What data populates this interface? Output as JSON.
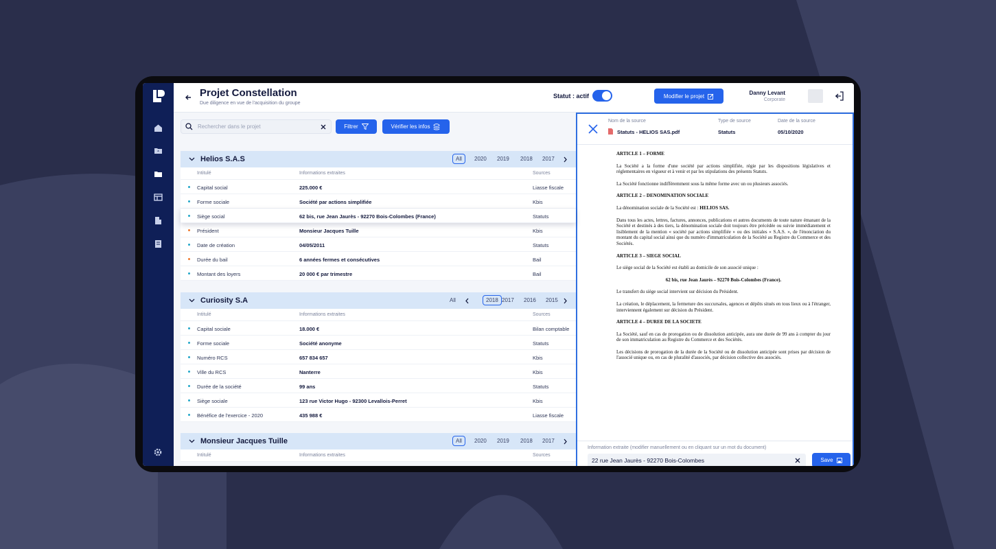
{
  "colors": {
    "accent": "#2563eb",
    "sidebar": "#0f1f57",
    "background": "#2a2e4b"
  },
  "header": {
    "title": "Projet Constellation",
    "subtitle": "Due diligence en vue de l'acquisition du groupe",
    "status_label": "Statut : actif",
    "status_on": true,
    "edit_button": "Modifier le projet"
  },
  "user": {
    "name": "Danny Levant",
    "role": "Corporate"
  },
  "sidebar": {
    "icons": [
      "home-icon",
      "folder-upload-icon",
      "folder-icon",
      "layout-icon",
      "building-icon",
      "document-icon",
      "settings-icon"
    ]
  },
  "toolbar": {
    "search_placeholder": "Rechercher dans le projet",
    "filter_label": "Filtrer",
    "verify_label": "Vérifier les infos"
  },
  "columns": {
    "c1": "Intitulé",
    "c2": "Informations extraites",
    "c3": "Sources"
  },
  "sections": [
    {
      "name": "Helios S.A.S",
      "years": [
        "All",
        "2020",
        "2019",
        "2018",
        "2017"
      ],
      "selected": "All",
      "rows": [
        {
          "label": "Capital social",
          "value": "225.000 €",
          "source": "Liasse fiscale",
          "dot": "#22a7c9"
        },
        {
          "label": "Forme sociale",
          "value": "Société par actions simplifiée",
          "source": "Kbis",
          "dot": "#22a7c9"
        },
        {
          "label": "Siège social",
          "value": "62 bis, rue Jean Jaurès - 92270 Bois-Colombes (France)",
          "source": "Statuts",
          "dot": "#22a7c9"
        },
        {
          "label": "Président",
          "value": "Monsieur Jacques Tuille",
          "source": "Kbis",
          "dot": "#f07a2f"
        },
        {
          "label": "Date de création",
          "value": "04/05/2011",
          "source": "Statuts",
          "dot": "#22a7c9"
        },
        {
          "label": "Durée du bail",
          "value": "6 années fermes et consécutives",
          "source": "Bail",
          "dot": "#f07a2f"
        },
        {
          "label": "Montant des loyers",
          "value": "20 000 € par trimestre",
          "source": "Bail",
          "dot": "#22a7c9"
        }
      ]
    },
    {
      "name": "Curiosity S.A",
      "years": [
        "All",
        "2018",
        "2017",
        "2016",
        "2015"
      ],
      "selected": "2018",
      "rows": [
        {
          "label": "Capital sociale",
          "value": "18.000 €",
          "source": "Bilan comptable",
          "dot": "#22a7c9"
        },
        {
          "label": "Forme sociale",
          "value": "Société anonyme",
          "source": "Statuts",
          "dot": "#22a7c9"
        },
        {
          "label": "Numéro RCS",
          "value": "657 834 657",
          "source": "Kbis",
          "dot": "#22a7c9"
        },
        {
          "label": "Ville du RCS",
          "value": "Nanterre",
          "source": "Kbis",
          "dot": "#22a7c9"
        },
        {
          "label": "Durée de la société",
          "value": "99 ans",
          "source": "Statuts",
          "dot": "#22a7c9"
        },
        {
          "label": "Siège sociale",
          "value": "123 rue Victor Hugo - 92300 Levallois-Perret",
          "source": "Kbis",
          "dot": "#22a7c9"
        },
        {
          "label": "Bénéfice de l'exercice - 2020",
          "value": "435 988 €",
          "source": "Liasse fiscale",
          "dot": "#22a7c9"
        }
      ]
    },
    {
      "name": "Monsieur Jacques Tuille",
      "years": [
        "All",
        "2020",
        "2019",
        "2018",
        "2017"
      ],
      "selected": "All",
      "rows": []
    }
  ],
  "panel": {
    "source_name_label": "Nom de la source",
    "source_name": "Statuts - HELIOS SAS.pdf",
    "source_type_label": "Type de source",
    "source_type": "Statuts",
    "source_date_label": "Date de la source",
    "source_date": "05/10/2020",
    "doc": {
      "a1_title": "ARTICLE 1 – FORME",
      "a1_p1": "La Société a la forme d'une société par actions simplifiée, régie par les dispositions législatives et réglementaires en vigueur et à venir et par les stipulations des présents Statuts.",
      "a1_p2": "La Société fonctionne indifféremment sous la même forme avec un ou plusieurs associés.",
      "a2_title": "ARTICLE 2 – DENOMINATION SOCIALE",
      "a2_p1_prefix": "La dénomination sociale de la Société est : ",
      "a2_p1_bold": "HELIOS SAS.",
      "a2_p2": "Dans tous les actes, lettres, factures, annonces, publications et autres documents de toute nature émanant de la Société et destinés à des tiers, la dénomination sociale doit toujours être précédée ou suivie immédiatement et lisiblement de la mention « société par actions simplifiée » ou des initiales « S.A.S. », de l'énonciation du montant du capital social ainsi que du numéro d'immatriculation de la Société au Registre du Commerce et des Sociétés.",
      "a3_title": "ARTICLE 3 – SIEGE SOCIAL",
      "a3_p1": "Le siège social de la Société est établi au domicile de son associé unique :",
      "a3_addr": "62 bis, rue Jean Jaurès – 92270 Bois-Colombes (France).",
      "a3_p2": "Le transfert du siège social intervient sur décision du Président.",
      "a3_p3": "La création, le déplacement, la fermeture des succursales, agences et dépôts situés en tous lieux ou à l'étranger, interviennent également sur décision du Président.",
      "a4_title": "ARTICLE 4 – DUREE DE LA SOCIETE",
      "a4_p1": "La Société, sauf en cas de prorogation ou de dissolution anticipée, aura une durée de 99 ans à compter du jour de son immatriculation au Registre du Commerce et des Sociétés.",
      "a4_p2": "Les décisions de prorogation de la durée de la Société ou de dissolution anticipée sont prises par décision de l'associé unique ou, en cas de pluralité d'associés, par décision collective des associés."
    },
    "extract_label": "Information extraite (modifier manuellement ou en cliquant sur un mot du document)",
    "extract_value": "22 rue Jean Jaurès - 92270 Bois-Colombes",
    "save_label": "Save"
  }
}
